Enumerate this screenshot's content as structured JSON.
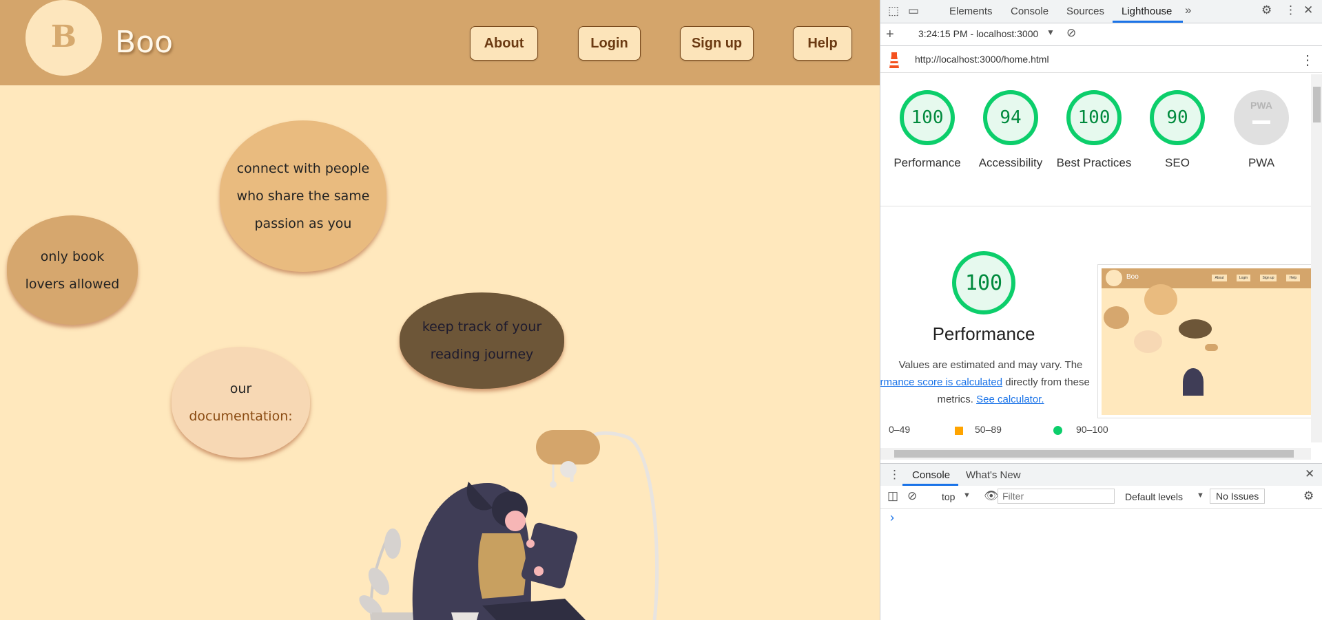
{
  "app": {
    "logo_letter": "B",
    "brand": "Boo",
    "nav": [
      "About",
      "Login",
      "Sign up",
      "Help"
    ],
    "bubbles": {
      "book_lovers": [
        "only book",
        "lovers allowed"
      ],
      "connect": [
        "connect with people",
        "who share the same",
        "passion as you"
      ],
      "track": [
        "keep track of your",
        "reading journey"
      ],
      "docs": [
        "our",
        "documentation:"
      ]
    },
    "colors": {
      "header": "#d4a56b",
      "page": "#ffe8bd",
      "bubble_light": "#f7d7b3",
      "bubble_mid": "#e8b87d",
      "bubble_dark": "#6b5436",
      "link": "#8a4b12"
    }
  },
  "devtools": {
    "tabs": [
      "Elements",
      "Console",
      "Sources",
      "Lighthouse"
    ],
    "active_tab": "Lighthouse",
    "report_select": "3:24:15 PM - localhost:3000",
    "url": "http://localhost:3000/home.html",
    "scores": [
      {
        "label": "Performance",
        "value": "100"
      },
      {
        "label": "Accessibility",
        "value": "94"
      },
      {
        "label": "Best Practices",
        "value": "100"
      },
      {
        "label": "SEO",
        "value": "90"
      },
      {
        "label": "PWA",
        "value": ""
      }
    ],
    "pwa_badge": "PWA",
    "performance": {
      "score": "100",
      "title": "Performance",
      "desc1": "Values are estimated and may vary. The",
      "link1": "rformance score is calculated",
      "desc2": "directly from these",
      "desc3": "metrics.",
      "link2": "See calculator."
    },
    "legend": [
      {
        "label": "0–49",
        "color": "#ff4e42"
      },
      {
        "label": "50–89",
        "color": "#ffa400"
      },
      {
        "label": "90–100",
        "color": "#0cce6b"
      }
    ],
    "console_tabs": [
      "Console",
      "What's New"
    ],
    "console_context": "top",
    "filter_placeholder": "Filter",
    "levels": "Default levels",
    "issues": "No Issues",
    "prompt": "›",
    "thumb": {
      "brand": "Boo",
      "nav": [
        "About",
        "Login",
        "Sign up",
        "Help"
      ]
    }
  }
}
